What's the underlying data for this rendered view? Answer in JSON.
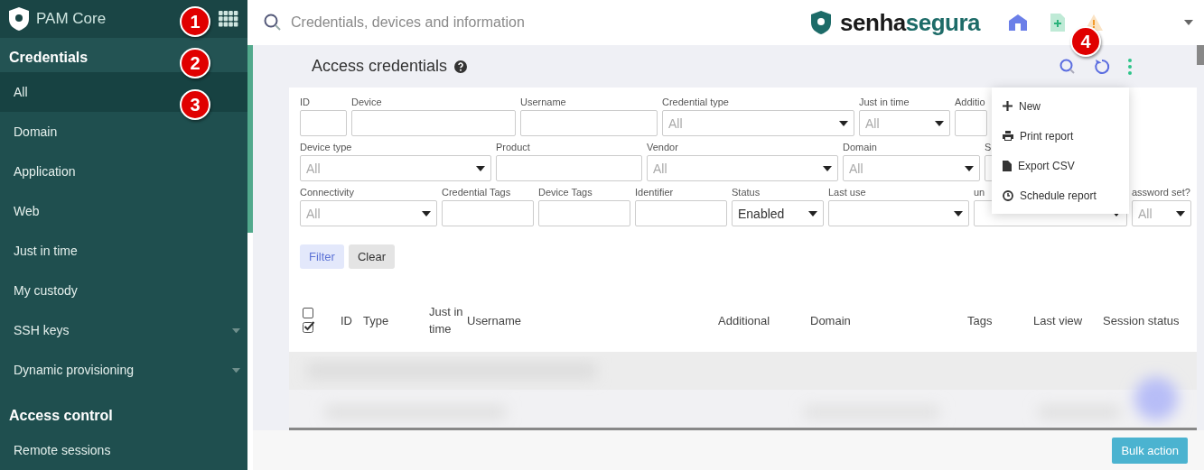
{
  "sidebar": {
    "product": "PAM Core",
    "sections": [
      {
        "title": "Credentials",
        "highlighted": true,
        "items": [
          {
            "label": "All",
            "selected": true,
            "expandable": false
          },
          {
            "label": "Domain",
            "selected": false,
            "expandable": false
          },
          {
            "label": "Application",
            "selected": false,
            "expandable": false
          },
          {
            "label": "Web",
            "selected": false,
            "expandable": false
          },
          {
            "label": "Just in time",
            "selected": false,
            "expandable": false
          },
          {
            "label": "My custody",
            "selected": false,
            "expandable": false
          },
          {
            "label": "SSH keys",
            "selected": false,
            "expandable": true
          },
          {
            "label": "Dynamic provisioning",
            "selected": false,
            "expandable": true
          }
        ]
      },
      {
        "title": "Access control",
        "highlighted": false,
        "items": [
          {
            "label": "Remote sessions",
            "selected": false,
            "expandable": false
          }
        ]
      }
    ]
  },
  "search": {
    "placeholder": "Credentials, devices and information"
  },
  "brand": "**senha**segura",
  "page": {
    "title": "Access credentials"
  },
  "filters": [
    [
      {
        "label": "ID",
        "kind": "text"
      },
      {
        "label": "Device",
        "kind": "text"
      },
      {
        "label": "Username",
        "kind": "text"
      },
      {
        "label": "Credential type",
        "kind": "select",
        "placeholder": "All"
      },
      {
        "label": "Just in time",
        "kind": "select",
        "placeholder": "All"
      },
      {
        "label": "Additio",
        "kind": "text"
      }
    ],
    [
      {
        "label": "Device type",
        "kind": "select",
        "placeholder": "All"
      },
      {
        "label": "Product",
        "kind": "text"
      },
      {
        "label": "Vendor",
        "kind": "select",
        "placeholder": "All"
      },
      {
        "label": "Domain",
        "kind": "select",
        "placeholder": "All"
      },
      {
        "label": "S",
        "kind": "text"
      }
    ],
    [
      {
        "label": "Connectivity",
        "kind": "select",
        "placeholder": "All"
      },
      {
        "label": "Credential Tags",
        "kind": "text"
      },
      {
        "label": "Device Tags",
        "kind": "text"
      },
      {
        "label": "Identifier",
        "kind": "text"
      },
      {
        "label": "Status",
        "kind": "select",
        "value": "Enabled"
      },
      {
        "label": "Last use",
        "kind": "select"
      },
      {
        "label": "un",
        "kind": "select"
      },
      {
        "label": "assword set?",
        "kind": "select",
        "placeholder": "All"
      }
    ]
  ],
  "filter_buttons": [
    {
      "label": "Filter",
      "primary": true
    },
    {
      "label": "Clear",
      "primary": false
    }
  ],
  "table": {
    "select_all": {
      "checked": false
    },
    "columns": [
      "ID",
      "Type",
      "Just in time",
      "Username",
      "Additional",
      "Domain",
      "Tags",
      "Last view",
      "Session status"
    ]
  },
  "actions_menu": [
    "New",
    "Print report",
    "Export CSV",
    "Schedule report"
  ],
  "bulk_action": "Bulk action",
  "annotations": [
    "1",
    "2",
    "3",
    "4"
  ]
}
